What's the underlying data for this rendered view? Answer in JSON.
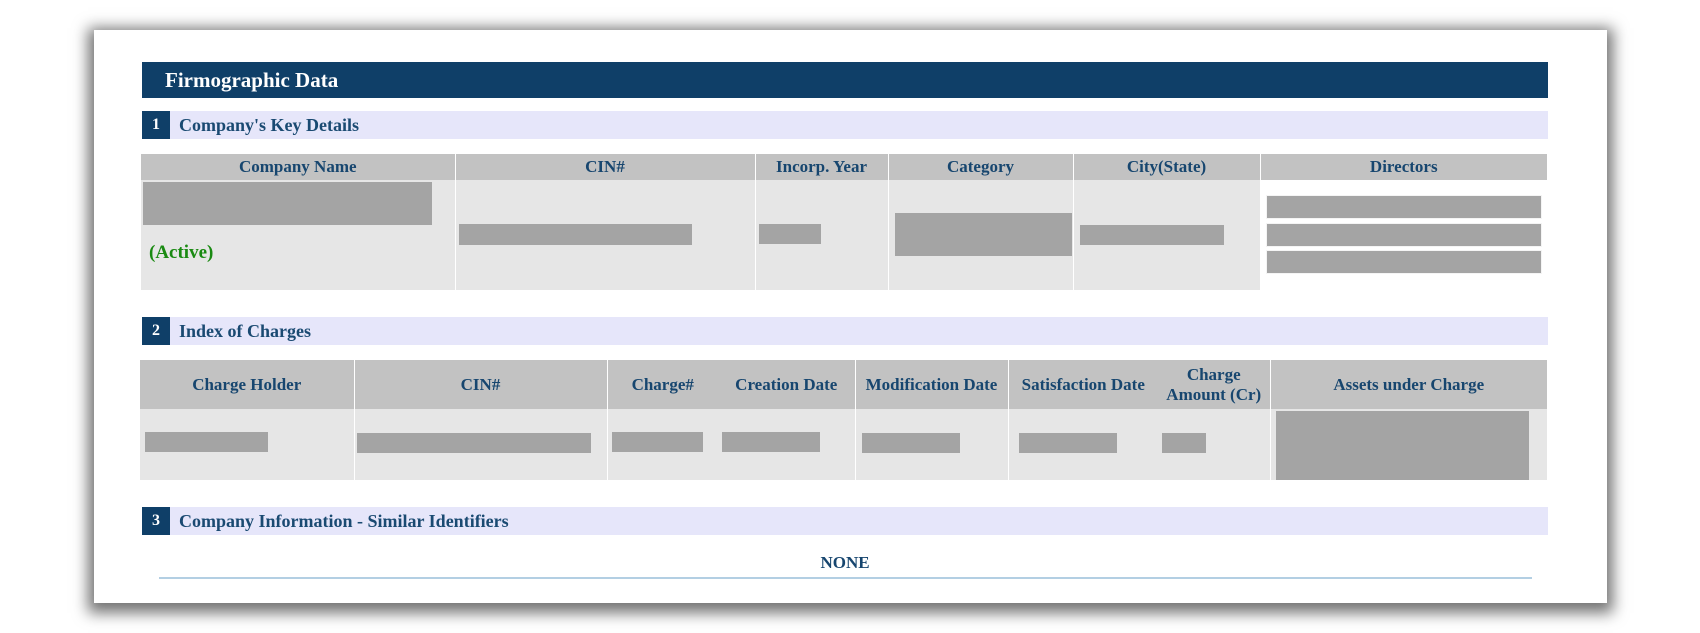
{
  "report": {
    "title": "Firmographic Data"
  },
  "sections": [
    {
      "number": "1",
      "title": "Company's Key Details"
    },
    {
      "number": "2",
      "title": "Index of Charges"
    },
    {
      "number": "3",
      "title": "Company Information - Similar Identifiers"
    }
  ],
  "key_details": {
    "headers": [
      "Company Name",
      "CIN#",
      "Incorp. Year",
      "Category",
      "City(State)",
      "Directors"
    ],
    "status": "(Active)",
    "redacted": true
  },
  "charges": {
    "headers": [
      "Charge Holder",
      "CIN#",
      "Charge#",
      "Creation Date",
      "Modification Date",
      "Satisfaction Date",
      "Charge Amount (Cr)",
      "Assets under Charge"
    ],
    "redacted": true
  },
  "similar_identifiers": {
    "value": "NONE"
  },
  "colors": {
    "banner": "#0f3f68",
    "section_band": "#e6e6fa",
    "header_cell": "#c2c2c2",
    "body_cell": "#e6e6e6",
    "redaction": "#a4a4a4",
    "status_active": "#1a8a12"
  }
}
